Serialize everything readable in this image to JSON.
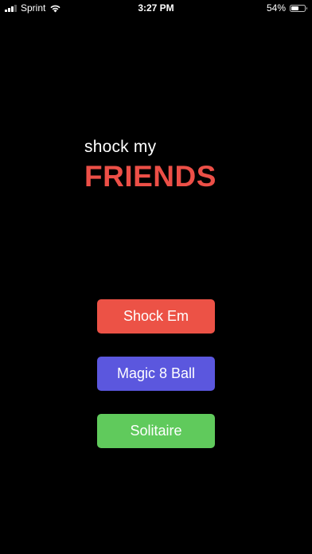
{
  "status_bar": {
    "carrier": "Sprint",
    "time": "3:27 PM",
    "battery_percent": "54%",
    "battery_level": 0.54,
    "signal_bars": 3,
    "icons": [
      "signal-icon",
      "wifi-icon",
      "battery-icon"
    ]
  },
  "title": {
    "subtitle": "shock my",
    "headline": "FRIENDS"
  },
  "buttons": {
    "shock_label": "Shock Em",
    "magic_label": "Magic 8 Ball",
    "solitaire_label": "Solitaire"
  },
  "colors": {
    "background": "#000000",
    "headline": "#ec4f47",
    "shock_button": "#ec5246",
    "magic_button": "#5b57de",
    "solitaire_button": "#60ca5c"
  }
}
